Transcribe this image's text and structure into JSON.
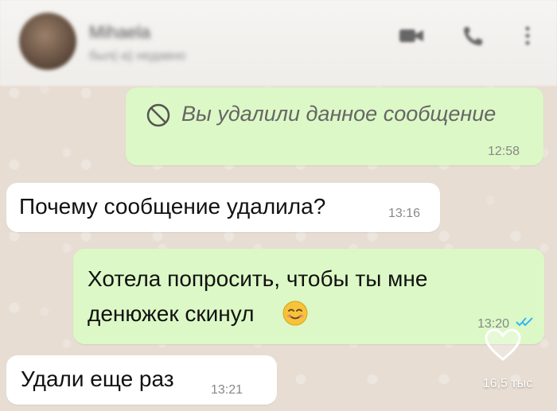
{
  "header": {
    "contact_name": "Mihaela",
    "contact_status": "был(-а) недавно",
    "icons": [
      "avatar",
      "video-icon",
      "call-icon",
      "more-icon"
    ]
  },
  "messages": [
    {
      "direction": "outgoing",
      "text": "Вы удалили данное сообщение",
      "time": "12:58",
      "deleted": true
    },
    {
      "direction": "incoming",
      "text": "Почему сообщение удалила?",
      "time": "13:16"
    },
    {
      "direction": "outgoing",
      "text_line1": "Хотела попросить, чтобы ты мне",
      "text_line2": "денюжек скинул",
      "emoji": "smiling-face-emoji",
      "time": "13:20",
      "status": "read-ticks"
    },
    {
      "direction": "incoming",
      "text": "Удали еще раз",
      "time": "13:21"
    }
  ],
  "overlay": {
    "like_count": "16,5 тыс"
  },
  "colors": {
    "outgoing_bubble": "#dcf8c6",
    "incoming_bubble": "#ffffff",
    "chat_background": "#e7ddd3",
    "read_ticks": "#34b7f1"
  }
}
